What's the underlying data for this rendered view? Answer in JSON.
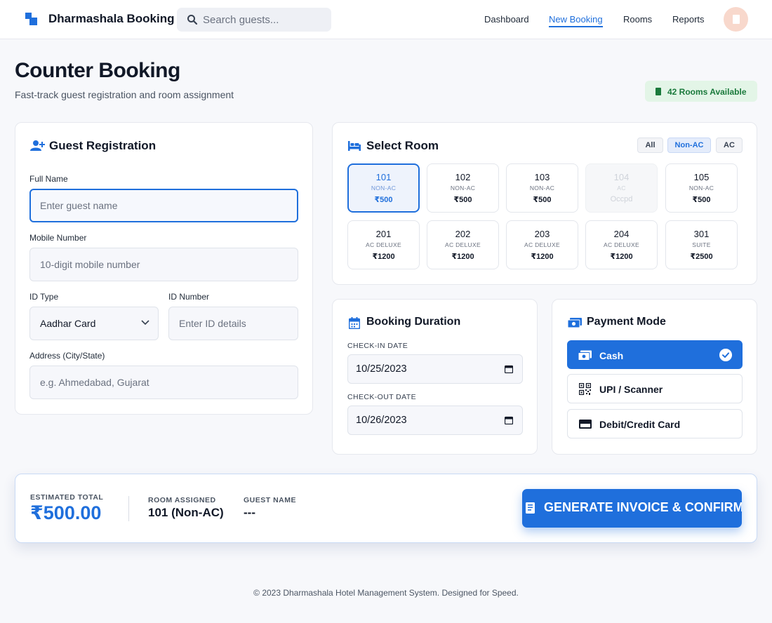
{
  "header": {
    "brand": "Dharmashala Booking",
    "search_placeholder": "Search guests...",
    "nav": [
      {
        "label": "Dashboard",
        "active": false
      },
      {
        "label": "New Booking",
        "active": true
      },
      {
        "label": "Rooms",
        "active": false
      },
      {
        "label": "Reports",
        "active": false
      }
    ]
  },
  "page": {
    "title": "Counter Booking",
    "subtitle": "Fast-track guest registration and room assignment",
    "availability": "42 Rooms Available"
  },
  "guest": {
    "title": "Guest Registration",
    "full_name_label": "Full Name",
    "full_name_placeholder": "Enter guest name",
    "mobile_label": "Mobile Number",
    "mobile_placeholder": "10-digit mobile number",
    "id_type_label": "ID Type",
    "id_type_value": "Aadhar Card",
    "id_number_label": "ID Number",
    "id_number_placeholder": "Enter ID details",
    "address_label": "Address (City/State)",
    "address_placeholder": "e.g. Ahmedabad, Gujarat"
  },
  "rooms": {
    "title": "Select Room",
    "filters": [
      {
        "label": "All",
        "active": false
      },
      {
        "label": "Non-AC",
        "active": true
      },
      {
        "label": "AC",
        "active": false
      }
    ],
    "items": [
      {
        "number": "101",
        "type": "NON-AC",
        "price": "₹500",
        "state": "selected"
      },
      {
        "number": "102",
        "type": "NON-AC",
        "price": "₹500",
        "state": "available"
      },
      {
        "number": "103",
        "type": "NON-AC",
        "price": "₹500",
        "state": "available"
      },
      {
        "number": "104",
        "type": "AC",
        "price": "Occpd",
        "state": "occupied"
      },
      {
        "number": "105",
        "type": "NON-AC",
        "price": "₹500",
        "state": "available"
      },
      {
        "number": "201",
        "type": "AC DELUXE",
        "price": "₹1200",
        "state": "available"
      },
      {
        "number": "202",
        "type": "AC DELUXE",
        "price": "₹1200",
        "state": "available"
      },
      {
        "number": "203",
        "type": "AC DELUXE",
        "price": "₹1200",
        "state": "available"
      },
      {
        "number": "204",
        "type": "AC DELUXE",
        "price": "₹1200",
        "state": "available"
      },
      {
        "number": "301",
        "type": "SUITE",
        "price": "₹2500",
        "state": "available"
      }
    ]
  },
  "duration": {
    "title": "Booking Duration",
    "checkin_label": "CHECK-IN DATE",
    "checkin_value": "10/25/2023",
    "checkout_label": "CHECK-OUT DATE",
    "checkout_value": "10/26/2023"
  },
  "payment": {
    "title": "Payment Mode",
    "options": [
      {
        "label": "Cash",
        "icon": "cash-icon",
        "active": true
      },
      {
        "label": "UPI / Scanner",
        "icon": "qr-code-icon",
        "active": false
      },
      {
        "label": "Debit/Credit Card",
        "icon": "credit-card-icon",
        "active": false
      }
    ]
  },
  "summary": {
    "total_label": "ESTIMATED TOTAL",
    "total_value": "₹500.00",
    "room_label": "ROOM ASSIGNED",
    "room_value": "101 (Non-AC)",
    "guest_label": "GUEST NAME",
    "guest_value": "---",
    "cta_label": "GENERATE INVOICE & CONFIRM"
  },
  "footer": "© 2023 Dharmashala Hotel Management System. Designed for Speed.",
  "colors": {
    "accent": "#1f6fdc",
    "success": "#1b7a3c",
    "background": "#f7f8fb"
  }
}
